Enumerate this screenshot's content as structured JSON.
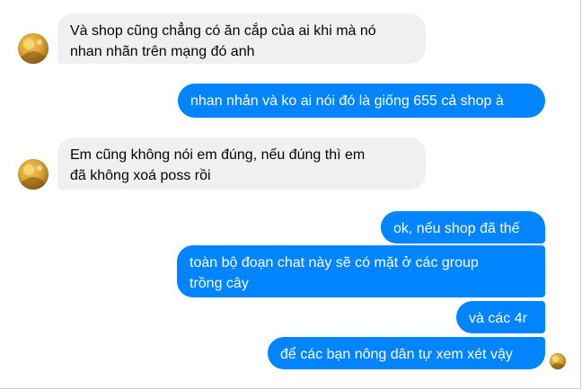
{
  "conversation": {
    "messages": [
      {
        "sender": "other",
        "line1": "Và shop cũng chẳng có ăn cắp của ai khi mà nó",
        "line2": "nhan nhãn trên mạng đó anh"
      },
      {
        "sender": "me",
        "text": "nhan nhản và ko ai nói đó là giống 655 cả shop à"
      },
      {
        "sender": "other",
        "line1": "Em cũng không nói em đúng, nếu đúng thì em",
        "line2": "đã không xoá poss rồi"
      },
      {
        "sender": "me",
        "text": "ok, nếu shop đã thế"
      },
      {
        "sender": "me",
        "line1": "toàn bộ đoạn chat này sẽ có mặt ở các group",
        "line2": "trồng cây"
      },
      {
        "sender": "me",
        "text": "và các 4r"
      },
      {
        "sender": "me",
        "text": "để các bạn nông dân tự xem xét vậy"
      }
    ]
  },
  "colors": {
    "outgoing": "#0084ff",
    "incoming": "#f0f0f0"
  },
  "icons": {
    "avatar": "user-avatar-icon",
    "seen": "seen-avatar-icon"
  }
}
